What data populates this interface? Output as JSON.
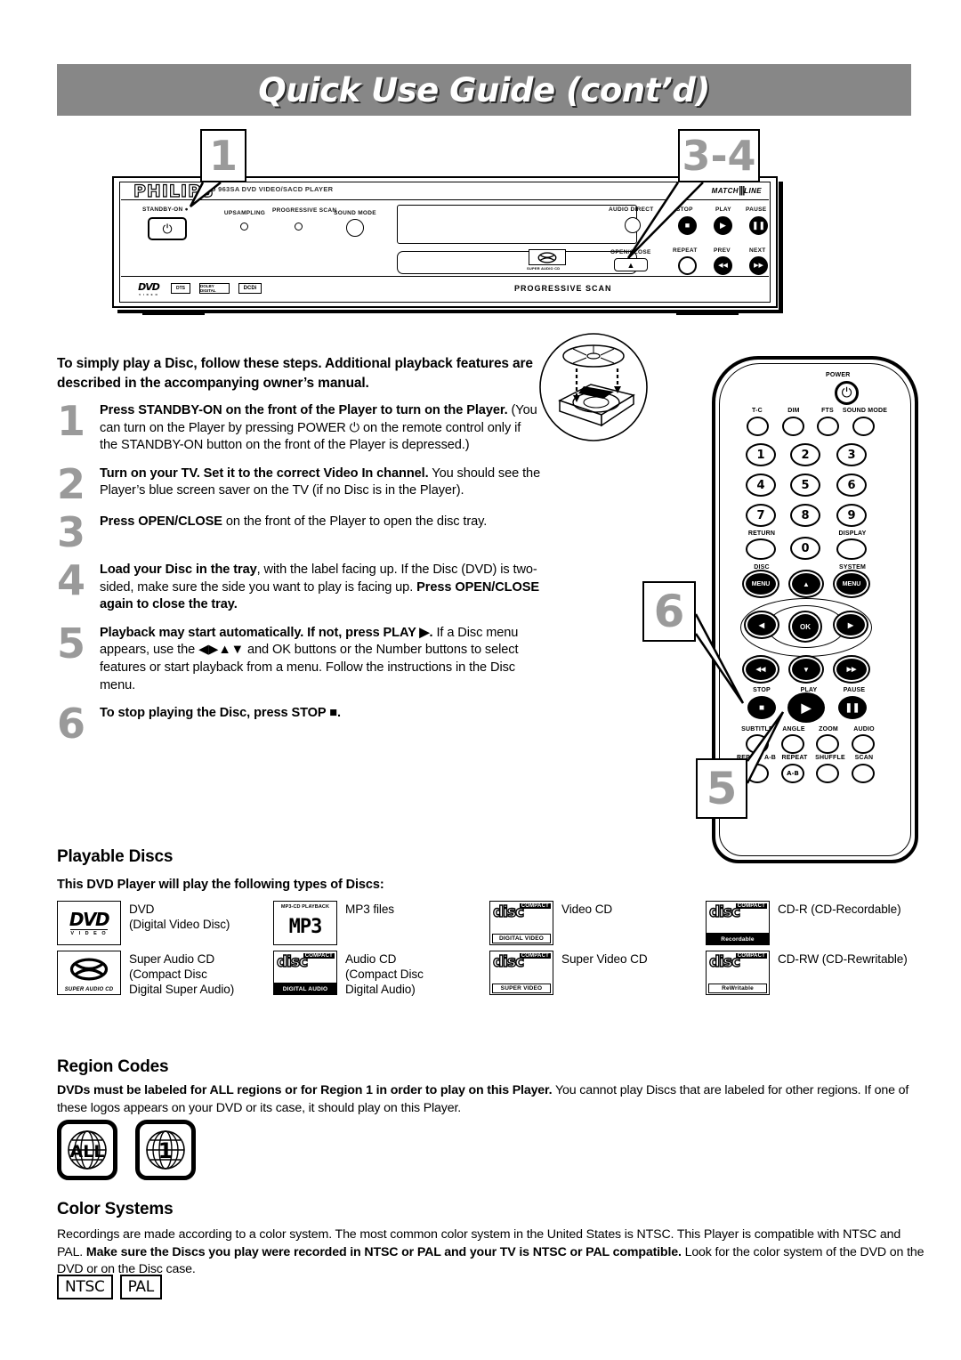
{
  "header": {
    "title": "Quick Use Guide (cont’d)"
  },
  "callouts": [
    {
      "id": "co-1",
      "label": "1"
    },
    {
      "id": "co-34",
      "label": "3-4"
    },
    {
      "id": "co-6",
      "label": "6"
    },
    {
      "id": "co-5",
      "label": "5"
    }
  ],
  "player": {
    "brand": "PHILIPS",
    "model": "DVD 963SA   DVD VIDEO/SACD PLAYER",
    "matchline": "MATCH",
    "matchline_suffix": "LINE",
    "standby_label": "STANDBY-ON",
    "standby_glyph": "⏻",
    "controls": [
      {
        "label": "UPSAMPLING",
        "type": "led"
      },
      {
        "label": "PROGRESSIVE SCAN",
        "type": "led"
      },
      {
        "label": "SOUND MODE",
        "type": "knob"
      }
    ],
    "audio_direct_label": "AUDIO DIRECT",
    "open_close_label": "OPEN/CLOSE",
    "open_close_glyph": "▲",
    "transport": [
      {
        "label": "STOP",
        "glyph": "■",
        "filled": true
      },
      {
        "label": "PLAY",
        "glyph": "▶",
        "filled": true
      },
      {
        "label": "PAUSE",
        "glyph": "❚❚",
        "filled": true
      },
      {
        "label": "REPEAT",
        "glyph": "",
        "filled": false
      },
      {
        "label": "PREV",
        "glyph": "◀◀",
        "filled": true
      },
      {
        "label": "NEXT",
        "glyph": "▶▶",
        "filled": true
      }
    ],
    "progressive_scan": "PROGRESSIVE SCAN",
    "sacd_caption": "SUPER AUDIO CD",
    "logos": [
      "DVD",
      "DTS",
      "DOLBY DIGITAL",
      "DCDi"
    ]
  },
  "intro": "To simply play a Disc, follow these steps. Additional playback features are described in the accompanying owner’s manual.",
  "steps": [
    {
      "num": "1",
      "bold": "Press STANDBY-ON on the front of the Player to turn on the Player.",
      "rest": " (You can turn on the Player by pressing POWER ⏻ on the remote control only if the STANDBY-ON button on the front of the Player is depressed.)"
    },
    {
      "num": "2",
      "bold": "Turn on your TV. Set it to the correct Video In channel.",
      "rest": " You should see the Player’s blue screen saver on the TV (if no Disc is in the Player)."
    },
    {
      "num": "3",
      "bold": "Press OPEN/CLOSE",
      "rest": " on the front of the Player to open the disc tray."
    },
    {
      "num": "4",
      "bold": "Load your Disc in the tray",
      "rest": ", with the label facing up. If the Disc (DVD) is two-sided, make sure the side you want to play is facing up. ",
      "bold2": "Press OPEN/CLOSE again to close the tray."
    },
    {
      "num": "5",
      "bold": "Playback may start automatically. If not, press PLAY ▶.",
      "rest": " If a Disc menu appears, use the ◀▶▲▼ and OK buttons or the Number buttons to select features or start playback from a menu. Follow the instructions in the Disc menu."
    },
    {
      "num": "6",
      "bold": "To stop playing the Disc, press STOP ■.",
      "rest": ""
    }
  ],
  "remote": {
    "power_label": "POWER",
    "power_glyph": "⏻",
    "function_row": [
      "T-C",
      "DIM",
      "FTS",
      "SOUND MODE"
    ],
    "number_buttons": [
      "1",
      "2",
      "3",
      "4",
      "5",
      "6",
      "7",
      "8",
      "9",
      "0"
    ],
    "return_label": "RETURN",
    "display_label": "DISPLAY",
    "disc_label": "DISC",
    "system_label": "SYSTEM",
    "menu_label": "MENU",
    "ok_label": "OK",
    "nav_glyphs": {
      "up": "▲",
      "down": "▼",
      "left": "◀",
      "right": "▶",
      "prev": "◀◀",
      "next": "▶▶"
    },
    "transport": [
      {
        "label": "STOP",
        "glyph": "■"
      },
      {
        "label": "PLAY",
        "glyph": "▶"
      },
      {
        "label": "PAUSE",
        "glyph": "❚❚"
      }
    ],
    "feature_row_1": [
      "SUBTITLE",
      "ANGLE",
      "ZOOM",
      "AUDIO"
    ],
    "feature_row_2": [
      "REPEAT A-B",
      "REPEAT",
      "SHUFFLE",
      "SCAN"
    ],
    "ab_label": "A-B"
  },
  "playable": {
    "heading": "Playable Discs",
    "subheading": "This DVD Player will play the following types of Discs:",
    "rows": [
      [
        {
          "icon": "dvd-video-logo",
          "icon_text": "DVD",
          "icon_sub": "V I D E O",
          "label": "DVD\n(Digital Video Disc)"
        },
        {
          "icon": "mp3-cd-logo",
          "icon_top": "MP3-CD PLAYBACK",
          "icon_text": "MP3",
          "label": "MP3 files"
        },
        {
          "icon": "compact-disc-digital-video-logo",
          "icon_text": "disc",
          "icon_compact": "COMPACT",
          "icon_band": "DIGITAL VIDEO",
          "label": "Video CD"
        },
        {
          "icon": "compact-disc-recordable-logo",
          "icon_text": "disc",
          "icon_compact": "COMPACT",
          "icon_band": "Recordable",
          "label": "CD-R (CD-Recordable)"
        }
      ],
      [
        {
          "icon": "super-audio-cd-logo",
          "icon_text": "SACD",
          "icon_band": "SUPER AUDIO CD",
          "label": "Super Audio CD\n(Compact Disc\nDigital Super Audio)"
        },
        {
          "icon": "compact-disc-digital-audio-logo",
          "icon_text": "disc",
          "icon_compact": "COMPACT",
          "icon_band": "DIGITAL AUDIO",
          "label": "Audio CD\n(Compact Disc\nDigital Audio)"
        },
        {
          "icon": "compact-disc-super-video-logo",
          "icon_text": "disc",
          "icon_compact": "COMPACT",
          "icon_band": "SUPER VIDEO",
          "label": "Super Video CD"
        },
        {
          "icon": "compact-disc-rewritable-logo",
          "icon_text": "disc",
          "icon_compact": "COMPACT",
          "icon_band": "ReWritable",
          "label": "CD-RW (CD-Rewritable)"
        }
      ]
    ]
  },
  "region": {
    "heading": "Region Codes",
    "body_bold": "DVDs must be labeled for ALL regions or for Region 1 in order to play on this Player.",
    "body_rest": " You cannot play Discs that are labeled for other regions. If one of these logos appears on your DVD or its case, it should play on this Player.",
    "logos": [
      "ALL",
      "1"
    ]
  },
  "color_systems": {
    "heading": "Color Systems",
    "line1": "Recordings are made according to a color system. The most common color system in the United States is NTSC.",
    "line2_pre": "This Player is compatible with NTSC and PAL. ",
    "line2_bold": "Make sure the Discs you play were recorded in NTSC or PAL and your TV is NTSC or PAL compatible.",
    "line2_post": " Look for the color system of the DVD on the DVD or on the Disc case.",
    "formats": [
      "NTSC",
      "PAL"
    ]
  }
}
